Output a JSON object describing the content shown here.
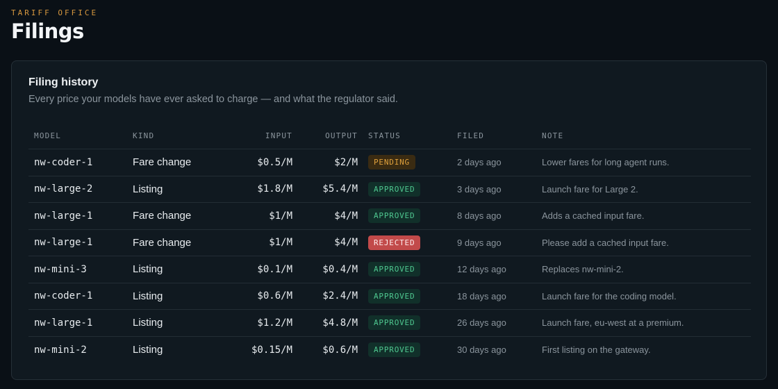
{
  "header": {
    "eyebrow": "TARIFF OFFICE",
    "title": "Filings"
  },
  "card": {
    "title": "Filing history",
    "subtitle": "Every price your models have ever asked to charge — and what the regulator said."
  },
  "table": {
    "columns": {
      "model": "MODEL",
      "kind": "KIND",
      "input": "INPUT",
      "output": "OUTPUT",
      "status": "STATUS",
      "filed": "FILED",
      "note": "NOTE"
    },
    "rows": [
      {
        "model": "nw-coder-1",
        "kind": "Fare change",
        "input": "$0.5/M",
        "output": "$2/M",
        "status": "PENDING",
        "status_key": "pending",
        "filed": "2 days ago",
        "note": "Lower fares for long agent runs."
      },
      {
        "model": "nw-large-2",
        "kind": "Listing",
        "input": "$1.8/M",
        "output": "$5.4/M",
        "status": "APPROVED",
        "status_key": "approved",
        "filed": "3 days ago",
        "note": "Launch fare for Large 2."
      },
      {
        "model": "nw-large-1",
        "kind": "Fare change",
        "input": "$1/M",
        "output": "$4/M",
        "status": "APPROVED",
        "status_key": "approved",
        "filed": "8 days ago",
        "note": "Adds a cached input fare."
      },
      {
        "model": "nw-large-1",
        "kind": "Fare change",
        "input": "$1/M",
        "output": "$4/M",
        "status": "REJECTED",
        "status_key": "rejected",
        "filed": "9 days ago",
        "note": "Please add a cached input fare."
      },
      {
        "model": "nw-mini-3",
        "kind": "Listing",
        "input": "$0.1/M",
        "output": "$0.4/M",
        "status": "APPROVED",
        "status_key": "approved",
        "filed": "12 days ago",
        "note": "Replaces nw-mini-2."
      },
      {
        "model": "nw-coder-1",
        "kind": "Listing",
        "input": "$0.6/M",
        "output": "$2.4/M",
        "status": "APPROVED",
        "status_key": "approved",
        "filed": "18 days ago",
        "note": "Launch fare for the coding model."
      },
      {
        "model": "nw-large-1",
        "kind": "Listing",
        "input": "$1.2/M",
        "output": "$4.8/M",
        "status": "APPROVED",
        "status_key": "approved",
        "filed": "26 days ago",
        "note": "Launch fare, eu-west at a premium."
      },
      {
        "model": "nw-mini-2",
        "kind": "Listing",
        "input": "$0.15/M",
        "output": "$0.6/M",
        "status": "APPROVED",
        "status_key": "approved",
        "filed": "30 days ago",
        "note": "First listing on the gateway."
      }
    ]
  },
  "colors": {
    "background": "#0a1016",
    "accent": "#d6973f",
    "approved": "#4fc890",
    "pending": "#e0a13c",
    "rejected": "#c24a4a"
  }
}
